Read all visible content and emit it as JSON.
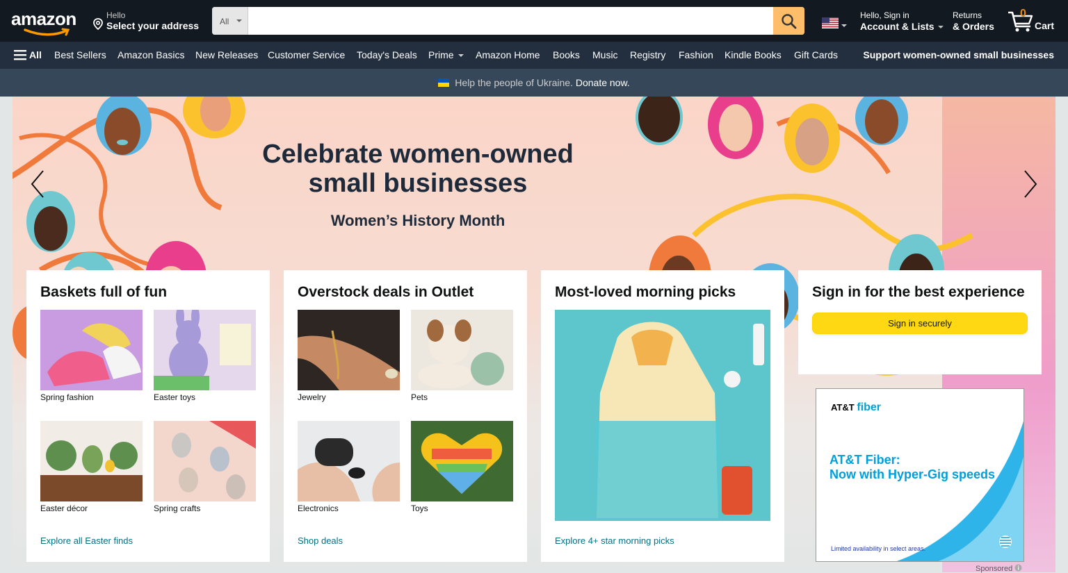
{
  "header": {
    "logo_text": "amazon",
    "address_line1": "Hello",
    "address_line2": "Select your address",
    "search_category": "All",
    "search_placeholder": "",
    "account_line1": "Hello, Sign in",
    "account_line2": "Account & Lists",
    "returns_line1": "Returns",
    "returns_line2": "& Orders",
    "cart_count": "0",
    "cart_label": "Cart"
  },
  "nav": {
    "all_label": "All",
    "items": [
      "Best Sellers",
      "Amazon Basics",
      "New Releases",
      "Customer Service",
      "Today's Deals",
      "Prime",
      "Amazon Home",
      "Books",
      "Music",
      "Registry",
      "Fashion",
      "Kindle Books",
      "Gift Cards"
    ],
    "promo": "Support women-owned small businesses"
  },
  "banner": {
    "text": "Help the people of Ukraine.",
    "link": "Donate now."
  },
  "hero": {
    "title_line1": "Celebrate women-owned",
    "title_line2": "small businesses",
    "subtitle": "Women’s History Month"
  },
  "cards": [
    {
      "title": "Baskets full of fun",
      "tiles": [
        "Spring fashion",
        "Easter toys",
        "Easter décor",
        "Spring crafts"
      ],
      "link": "Explore all Easter finds"
    },
    {
      "title": "Overstock deals in Outlet",
      "tiles": [
        "Jewelry",
        "Pets",
        "Electronics",
        "Toys"
      ],
      "link": "Shop deals"
    },
    {
      "title": "Most-loved morning picks",
      "link": "Explore 4+ star morning picks"
    }
  ],
  "signin": {
    "title": "Sign in for the best experience",
    "button": "Sign in securely"
  },
  "ad": {
    "brand": "AT&T",
    "brand_suffix": "fiber",
    "headline_line1": "AT&T Fiber:",
    "headline_line2": "Now with Hyper-Gig speeds",
    "fine_print": "Limited availability in select areas.",
    "sponsored": "Sponsored"
  },
  "colors": {
    "header_bg": "#131921",
    "nav_bg": "#232f3e",
    "banner_bg": "#37475a",
    "search_button": "#febd69",
    "signin_button": "#ffd814",
    "link": "#007185",
    "cart_count": "#f08804"
  }
}
